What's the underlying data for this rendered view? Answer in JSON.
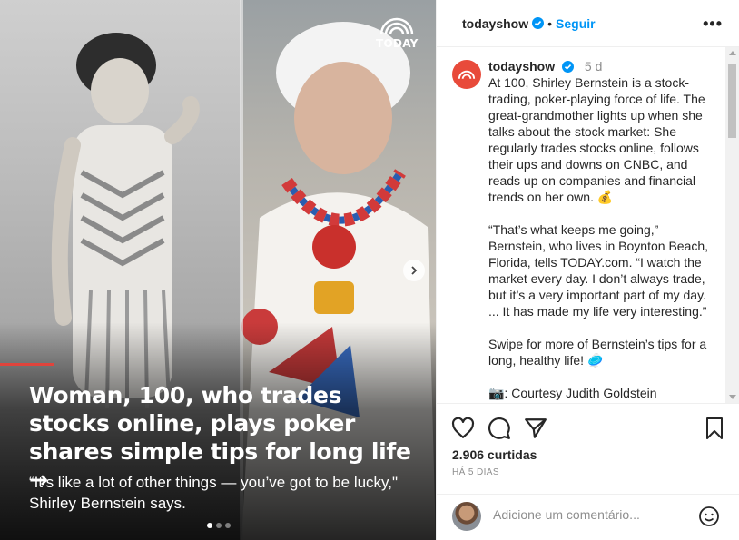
{
  "post": {
    "headline": "Woman, 100, who trades stocks online, plays poker shares simple tips for long life →",
    "subline": "“It’s like a lot of other things — you’ve got to be lucky,\" Shirley Bernstein says.",
    "brand_logo_text": "TODAY",
    "carousel": {
      "count": 3,
      "active": 1
    }
  },
  "header": {
    "username": "todayshow",
    "follow_label": "Seguir",
    "more_label": "•••"
  },
  "caption": {
    "username": "todayshow",
    "age": "5 d",
    "paragraphs": [
      "At 100, Shirley Bernstein is a stock-trading, poker-playing force of life. The great-grandmother lights up when she talks about the stock market: She regularly trades stocks online, follows their ups and downs on CNBC, and reads up on companies and financial trends on her own. 💰",
      "“That’s what keeps me going,” Bernstein, who lives in Boynton Beach, Florida, tells TODAY.com. “I watch the market every day. I don’t always trade, but it’s a very important part of my day. ... It has made my life very interesting.”",
      "Swipe for more of Bernstein’s tips for a long, healthy life! 🥏",
      "📷: Courtesy Judith Goldstein"
    ]
  },
  "stats": {
    "likes": "2.906 curtidas",
    "posted": "HÁ 5 DIAS"
  },
  "comment": {
    "placeholder": "Adicione um comentário..."
  },
  "colors": {
    "accent": "#0095f6",
    "brand": "#e84a3a",
    "headline_rule": "#e0443c"
  },
  "icons": [
    "today-logo-icon",
    "next-arrow-icon",
    "verified-icon",
    "more-icon",
    "heart-icon",
    "comment-icon",
    "share-icon",
    "bookmark-icon",
    "emoji-icon"
  ]
}
